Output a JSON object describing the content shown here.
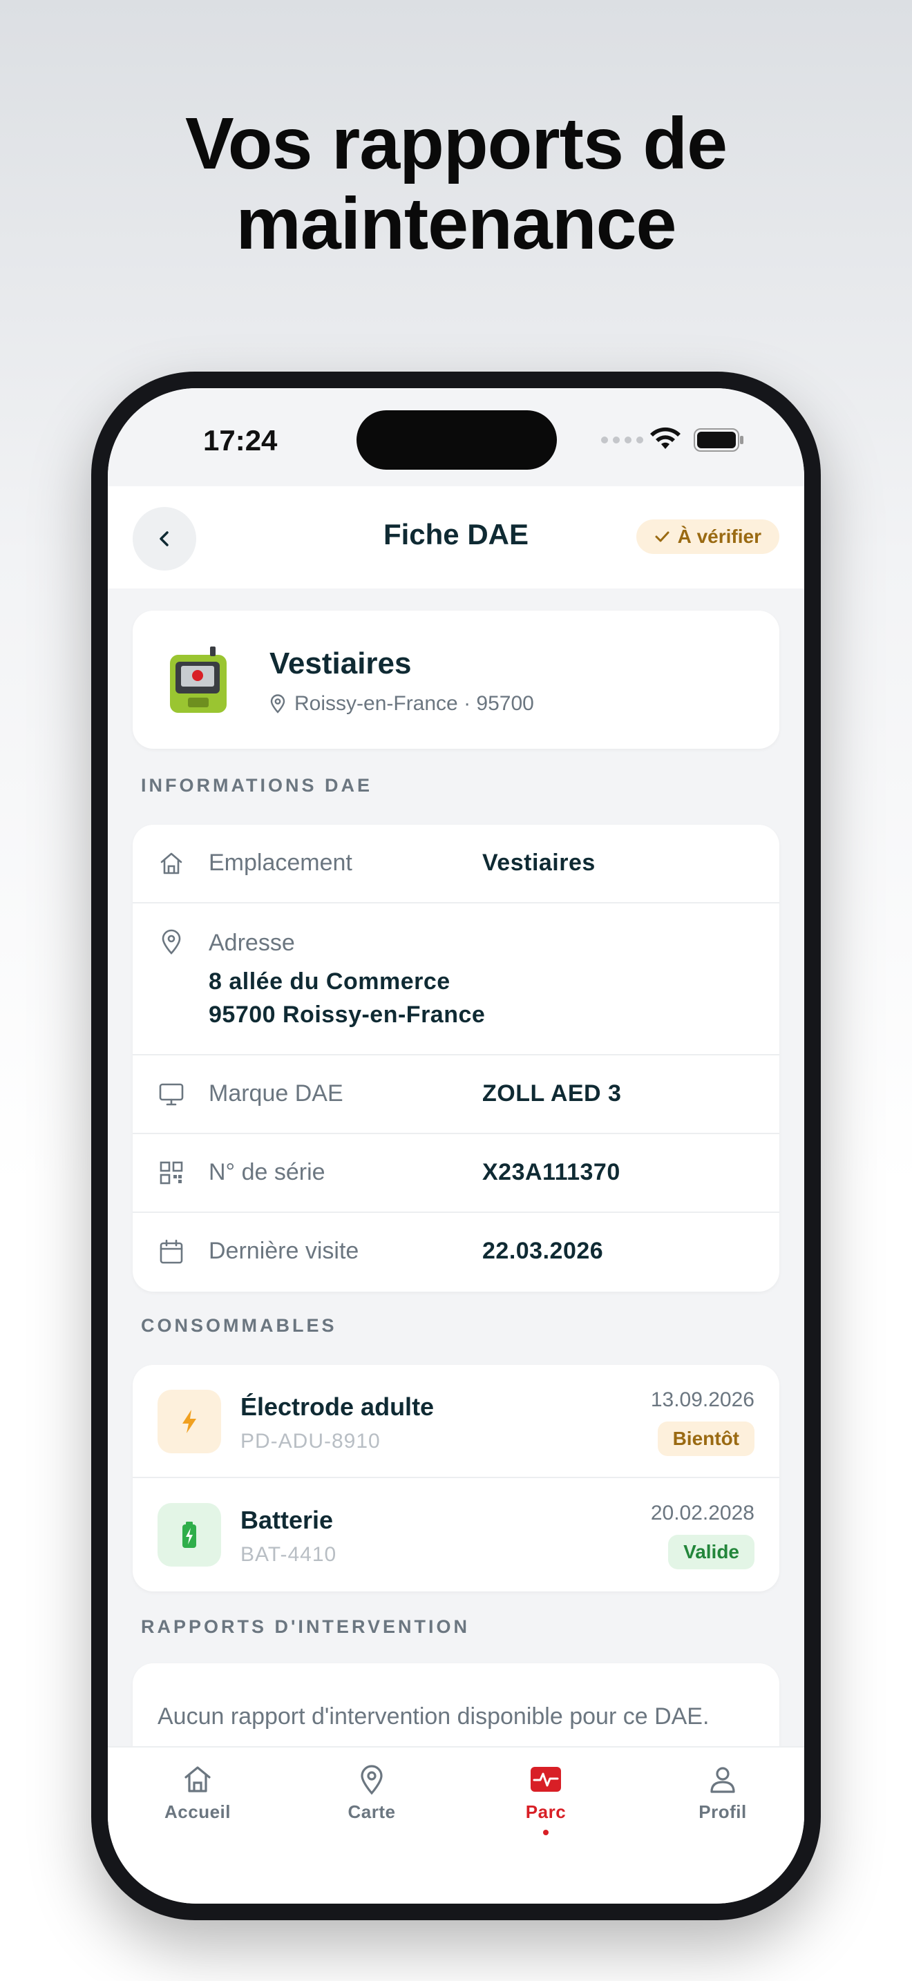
{
  "headline": {
    "line1": "Vos rapports de",
    "line2": "maintenance"
  },
  "status_bar": {
    "time": "17:24"
  },
  "header": {
    "title": "Fiche DAE",
    "status": "À vérifier"
  },
  "device": {
    "name": "Vestiaires",
    "location": "Roissy-en-France · 95700"
  },
  "info": {
    "section": "INFORMATIONS DAE",
    "emplacement_label": "Emplacement",
    "emplacement_value": "Vestiaires",
    "adresse_label": "Adresse",
    "adresse_line1": "8 allée du Commerce",
    "adresse_line2": "95700 Roissy-en-France",
    "marque_label": "Marque DAE",
    "marque_value": "ZOLL AED 3",
    "serie_label": "N° de série",
    "serie_value": "X23A111370",
    "visite_label": "Dernière visite",
    "visite_value": "22.03.2026"
  },
  "consumables": {
    "section": "CONSOMMABLES",
    "items": [
      {
        "name": "Électrode adulte",
        "code": "PD-ADU-8910",
        "date": "13.09.2026",
        "badge": "Bientôt"
      },
      {
        "name": "Batterie",
        "code": "BAT-4410",
        "date": "20.02.2028",
        "badge": "Valide"
      }
    ]
  },
  "reports": {
    "section": "RAPPORTS D'INTERVENTION",
    "empty_text": "Aucun rapport d'intervention disponible pour ce DAE."
  },
  "tabbar": {
    "items": [
      {
        "label": "Accueil",
        "icon": "home-icon"
      },
      {
        "label": "Carte",
        "icon": "map-pin-icon"
      },
      {
        "label": "Parc",
        "icon": "pulse-icon"
      },
      {
        "label": "Profil",
        "icon": "user-icon"
      }
    ],
    "active": "Parc"
  },
  "colors": {
    "accent": "#d81f26",
    "warning_bg": "#fdf0dc",
    "warning_text": "#9a6a12",
    "success_bg": "#e3f5e6",
    "success_text": "#23863b",
    "text_dark": "#0f2a33"
  }
}
